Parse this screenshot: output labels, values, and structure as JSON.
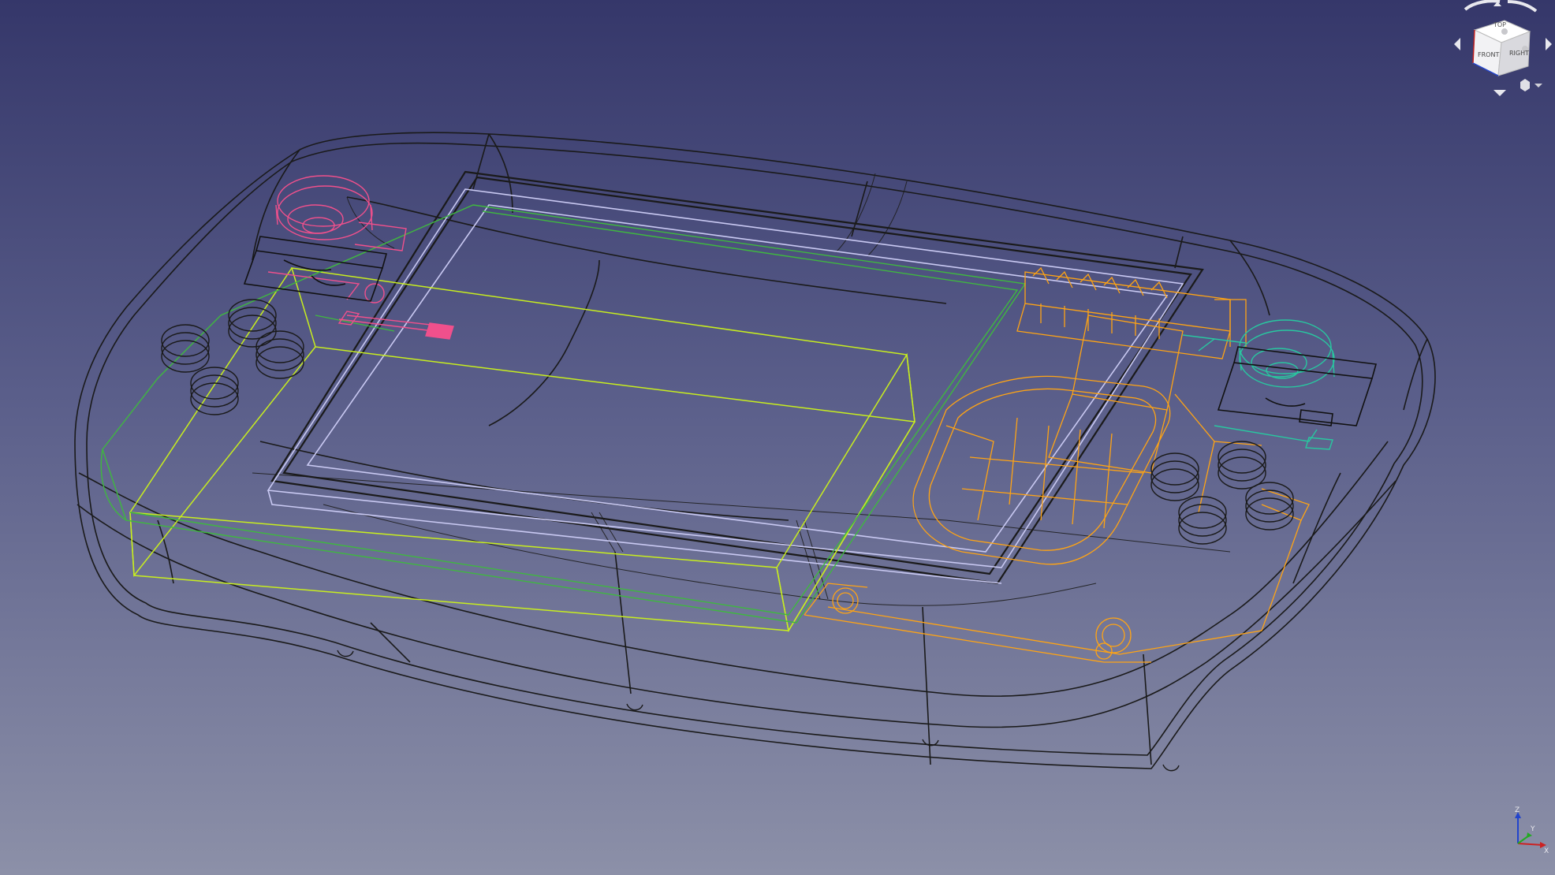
{
  "colors": {
    "background_top": "#35376a",
    "background_bottom": "#8c90a8",
    "body_outline": "#1a1a1a",
    "screen_outline": "#c9c9f2",
    "battery_outline": "#c8ee1e",
    "pcb_outline": "#3fb83f",
    "electronics_outline": "#ffa414",
    "left_stick": "#f0508c",
    "right_stick": "#28c8a0",
    "axis_x": "#cc2222",
    "axis_y": "#22aa22",
    "axis_z": "#2244cc"
  },
  "navigation_cube": {
    "top_face": "TOP",
    "front_face": "FRONT",
    "right_face": "RIGHT",
    "icons": [
      "rotate-left-icon",
      "rotate-right-icon",
      "arrow-up-icon",
      "arrow-down-icon",
      "arrow-left-icon",
      "arrow-right-icon",
      "cube-menu-icon"
    ]
  },
  "axis_indicator": {
    "x": "X",
    "y": "Y",
    "z": "Z"
  }
}
